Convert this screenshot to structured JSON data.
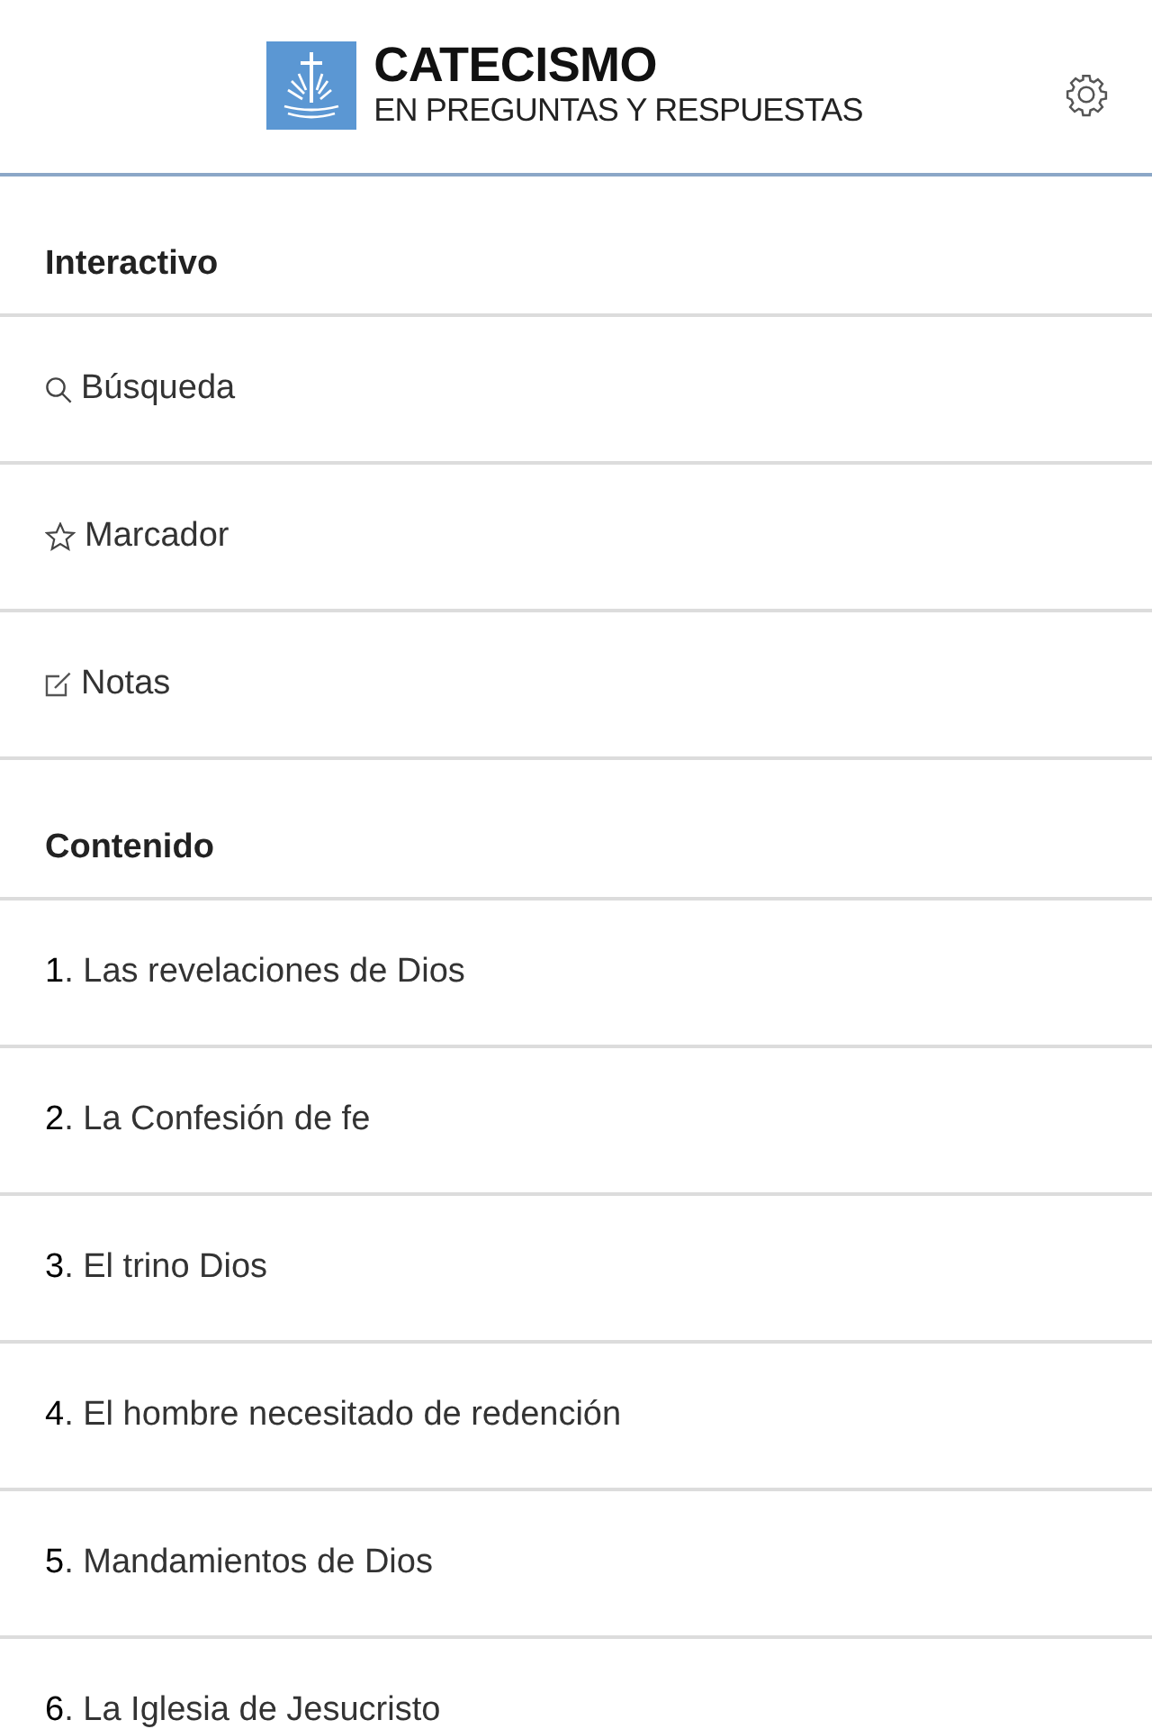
{
  "header": {
    "title": "CATECISMO",
    "subtitle": "EN PREGUNTAS Y RESPUESTAS"
  },
  "sections": [
    {
      "title": "Interactivo",
      "items": [
        {
          "kind": "search",
          "label": "Búsqueda"
        },
        {
          "kind": "bookmark",
          "label": "Marcador"
        },
        {
          "kind": "notes",
          "label": "Notas"
        }
      ]
    },
    {
      "title": "Contenido",
      "items": [
        {
          "kind": "chapter",
          "label": "**1**. Las revelaciones de Dios"
        },
        {
          "kind": "chapter",
          "label": "**2**. La Confesión de fe"
        },
        {
          "kind": "chapter",
          "label": "**3**. El trino Dios"
        },
        {
          "kind": "chapter",
          "label": "**4**. El hombre necesitado de redención"
        },
        {
          "kind": "chapter",
          "label": "**5**. Mandamientos de Dios"
        },
        {
          "kind": "chapter",
          "label": "**6**. La Iglesia de Jesucristo"
        }
      ]
    }
  ]
}
